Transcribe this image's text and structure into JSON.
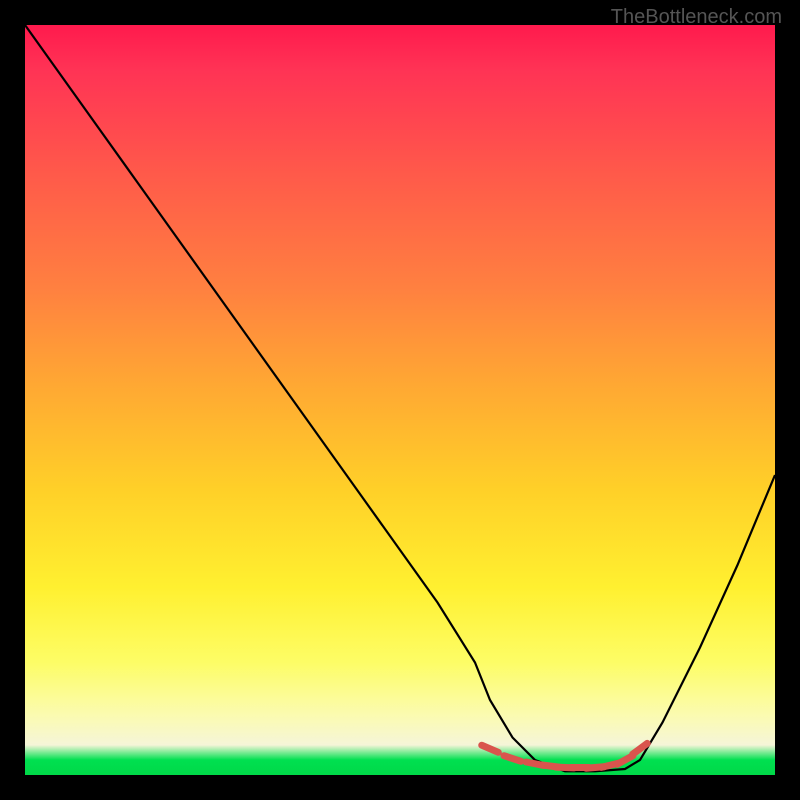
{
  "watermark": "TheBottleneck.com",
  "chart_data": {
    "type": "line",
    "title": "",
    "xlabel": "",
    "ylabel": "",
    "xlim": [
      0,
      100
    ],
    "ylim": [
      0,
      100
    ],
    "series": [
      {
        "name": "bottleneck-curve",
        "x": [
          0,
          5,
          10,
          15,
          20,
          25,
          30,
          35,
          40,
          45,
          50,
          55,
          60,
          62,
          65,
          68,
          72,
          76,
          80,
          82,
          85,
          90,
          95,
          100
        ],
        "values": [
          100,
          93,
          86,
          79,
          72,
          65,
          58,
          51,
          44,
          37,
          30,
          23,
          15,
          10,
          5,
          2,
          0.5,
          0.5,
          0.8,
          2,
          7,
          17,
          28,
          40
        ]
      }
    ],
    "markers": {
      "name": "highlight-dashes",
      "x": [
        62,
        65,
        68,
        70,
        72,
        74,
        76,
        78,
        80,
        82
      ],
      "values": [
        3.5,
        2.2,
        1.5,
        1.2,
        1.0,
        1.0,
        1.0,
        1.3,
        2.0,
        3.5
      ]
    },
    "gradient_stops": [
      {
        "pos": 0,
        "color": "#ff1a4d"
      },
      {
        "pos": 50,
        "color": "#ffd028"
      },
      {
        "pos": 96,
        "color": "#f5f5d8"
      },
      {
        "pos": 100,
        "color": "#00d848"
      }
    ]
  }
}
